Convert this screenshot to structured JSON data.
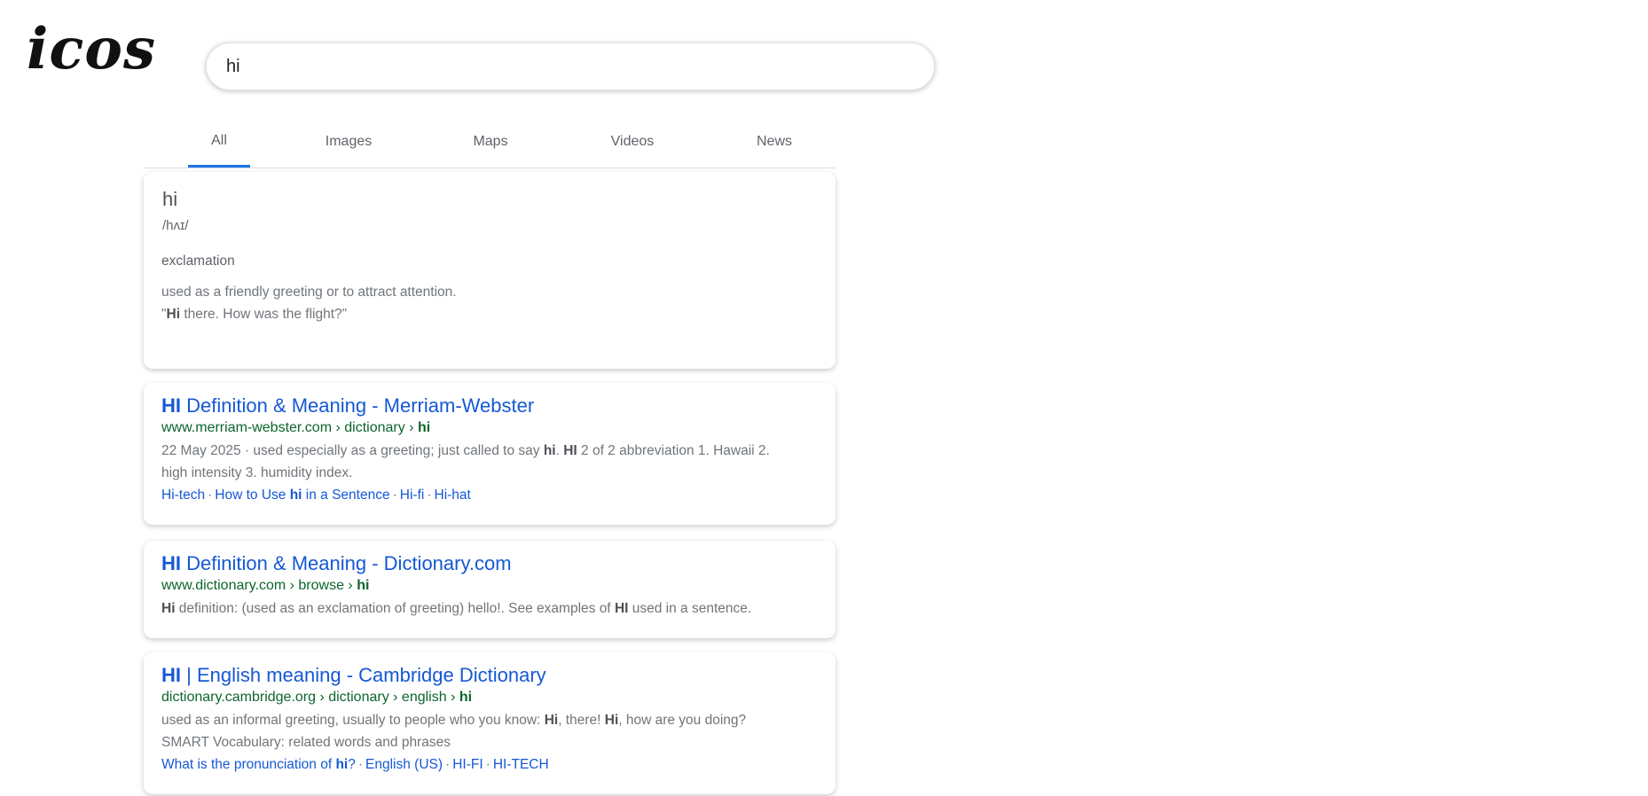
{
  "logo": "icos",
  "search": {
    "value": "hi"
  },
  "tabs": [
    "All",
    "Images",
    "Maps",
    "Videos",
    "News"
  ],
  "dictionary": {
    "word": "hi",
    "phonetic": "/hʌɪ/",
    "part_of_speech": "exclamation",
    "definition": "used as a friendly greeting or to attract attention.",
    "example_open": "\"",
    "example_bold": "Hi",
    "example_rest": " there. How was the flight?\""
  },
  "results": [
    {
      "title_bold": "HI",
      "title_rest": " Definition & Meaning - Merriam-Webster",
      "url_plain": "www.merriam-webster.com › dictionary › ",
      "url_bold": "hi",
      "snippet_line1": [
        "22 May 2025 · used especially as a greeting; just called to say ",
        "hi",
        ". ",
        "HI",
        " 2 of 2 abbreviation 1. Hawaii 2."
      ],
      "snippet_line2": "high intensity 3. humidity index.",
      "links": [
        {
          "pre": "Hi-tech",
          "bold": "",
          "post": ""
        },
        {
          "pre": "How to Use ",
          "bold": "hi",
          "post": " in a Sentence"
        },
        {
          "pre": "Hi-fi",
          "bold": "",
          "post": ""
        },
        {
          "pre": "Hi-hat",
          "bold": "",
          "post": ""
        }
      ]
    },
    {
      "title_bold": "HI",
      "title_rest": " Definition & Meaning - Dictionary.com",
      "url_plain": "www.dictionary.com › browse › ",
      "url_bold": "hi",
      "snippet_line1": [
        "",
        "Hi",
        " definition: (used as an exclamation of greeting) hello!. See examples of ",
        "HI",
        " used in a sentence."
      ]
    },
    {
      "title_bold": "HI",
      "title_rest": " | English meaning - Cambridge Dictionary",
      "url_plain": "dictionary.cambridge.org › dictionary › english › ",
      "url_bold": "hi",
      "snippet_line1": [
        "used as an informal greeting, usually to people who you know: ",
        "Hi",
        ", there! ",
        "Hi",
        ", how are you doing?"
      ],
      "snippet_line2": "SMART Vocabulary: related words and phrases",
      "links": [
        {
          "pre": "What is the pronunciation of ",
          "bold": "hi",
          "post": "?"
        },
        {
          "pre": "English (US)",
          "bold": "",
          "post": ""
        },
        {
          "pre": "HI-FI",
          "bold": "",
          "post": ""
        },
        {
          "pre": "HI-TECH",
          "bold": "",
          "post": ""
        }
      ]
    }
  ]
}
